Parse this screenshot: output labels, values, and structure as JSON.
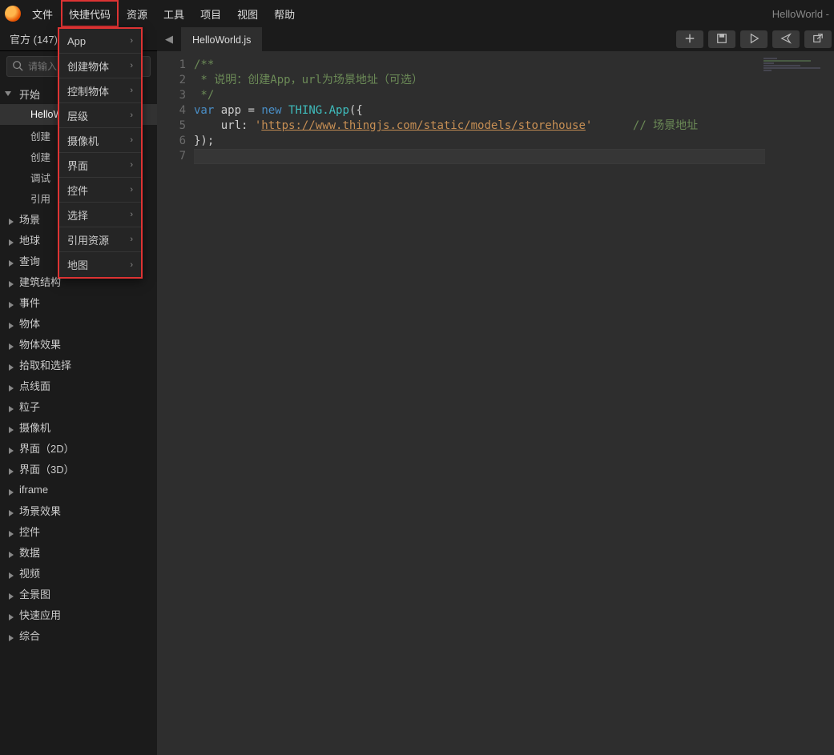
{
  "window": {
    "title_right": "HelloWorld -"
  },
  "menubar": {
    "items": [
      "文件",
      "快捷代码",
      "资源",
      "工具",
      "项目",
      "视图",
      "帮助"
    ],
    "highlighted_index": 1
  },
  "dropdown": {
    "items": [
      "App",
      "创建物体",
      "控制物体",
      "层级",
      "摄像机",
      "界面",
      "控件",
      "选择",
      "引用资源",
      "地图"
    ]
  },
  "sidebar": {
    "tab_label": "官方 (147)",
    "search_placeholder": "请输入",
    "expanded_group": "开始",
    "expanded_children": [
      "HelloWorld",
      "创建",
      "创建",
      "调试",
      "引用"
    ],
    "selected_child_index": 0,
    "groups": [
      "场景",
      "地球",
      "查询",
      "建筑结构",
      "事件",
      "物体",
      "物体效果",
      "拾取和选择",
      "点线面",
      "粒子",
      "摄像机",
      "界面（2D）",
      "界面（3D）",
      "iframe",
      "场景效果",
      "控件",
      "数据",
      "视频",
      "全景图",
      "快速应用",
      "综合"
    ]
  },
  "editor": {
    "open_tab": "HelloWorld.js",
    "toolbar_icons": [
      "plus",
      "save",
      "run",
      "send",
      "open-external"
    ],
    "line_count": 7,
    "code": {
      "l1": "/**",
      "l2_a": " * 说明：创建App，url为场景地址（可选）",
      "l3": " */",
      "l4_var": "var",
      "l4_app": " app = ",
      "l4_new": "new",
      "l4_thing": " THING",
      "l4_appcls": ".App",
      "l4_open": "({",
      "l5_key": "    url: ",
      "l5_q1": "'",
      "l5_url": "https://www.thingjs.com/static/models/storehouse",
      "l5_q2": "'",
      "l5_comment": "      // 场景地址",
      "l6": "});",
      "l7": ""
    }
  }
}
